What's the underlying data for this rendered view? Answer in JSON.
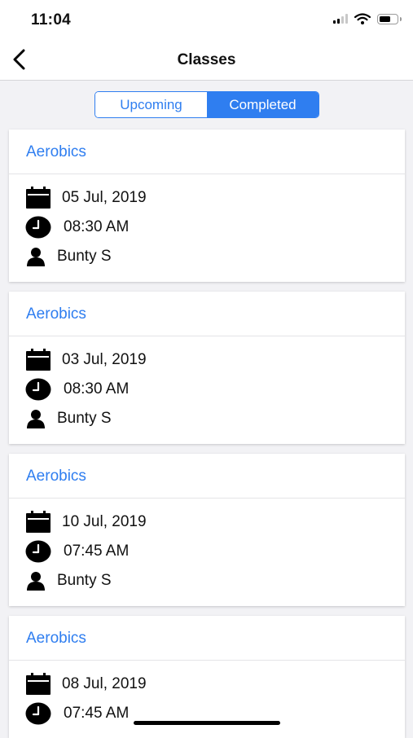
{
  "status_bar": {
    "time": "11:04"
  },
  "nav": {
    "title": "Classes"
  },
  "segments": [
    {
      "label": "Upcoming",
      "selected": false
    },
    {
      "label": "Completed",
      "selected": true
    }
  ],
  "colors": {
    "accent": "#2f7ef0",
    "background": "#f2f2f5"
  },
  "icons": {
    "date": "calendar-icon",
    "time": "clock-icon",
    "trainer": "person-icon"
  },
  "classes": [
    {
      "name": "Aerobics",
      "date": "05 Jul, 2019",
      "time": "08:30 AM",
      "trainer": "Bunty S"
    },
    {
      "name": "Aerobics",
      "date": "03 Jul, 2019",
      "time": "08:30 AM",
      "trainer": "Bunty S"
    },
    {
      "name": "Aerobics",
      "date": "10 Jul, 2019",
      "time": "07:45 AM",
      "trainer": "Bunty S"
    },
    {
      "name": "Aerobics",
      "date": "08 Jul, 2019",
      "time": "07:45 AM",
      "trainer": ""
    }
  ]
}
